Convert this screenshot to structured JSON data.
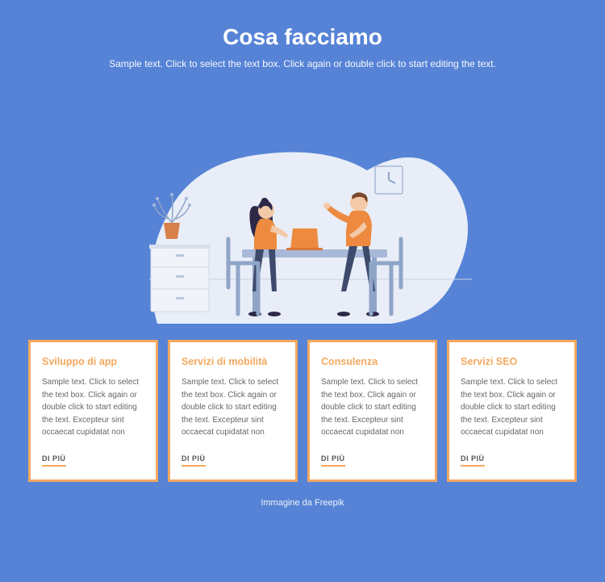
{
  "header": {
    "title": "Cosa facciamo",
    "subtitle": "Sample text. Click to select the text box. Click again or double click to start editing the text."
  },
  "cards": [
    {
      "title": "Sviluppo di app",
      "body": "Sample text. Click to select the text box. Click again or double click to start editing the text. Excepteur sint occaecat cupidatat non",
      "link": "DI PIÙ"
    },
    {
      "title": "Servizi di mobilità",
      "body": "Sample text. Click to select the text box. Click again or double click to start editing the text. Excepteur sint occaecat cupidatat non",
      "link": "DI PIÙ"
    },
    {
      "title": "Consulenza",
      "body": "Sample text. Click to select the text box. Click again or double click to start editing the text. Excepteur sint occaecat cupidatat non",
      "link": "DI PIÙ"
    },
    {
      "title": "Servizi SEO",
      "body": "Sample text. Click to select the text box. Click again or double click to start editing the text. Excepteur sint occaecat cupidatat non",
      "link": "DI PIÙ"
    }
  ],
  "footer": {
    "credit": "Immagine da Freepik"
  }
}
